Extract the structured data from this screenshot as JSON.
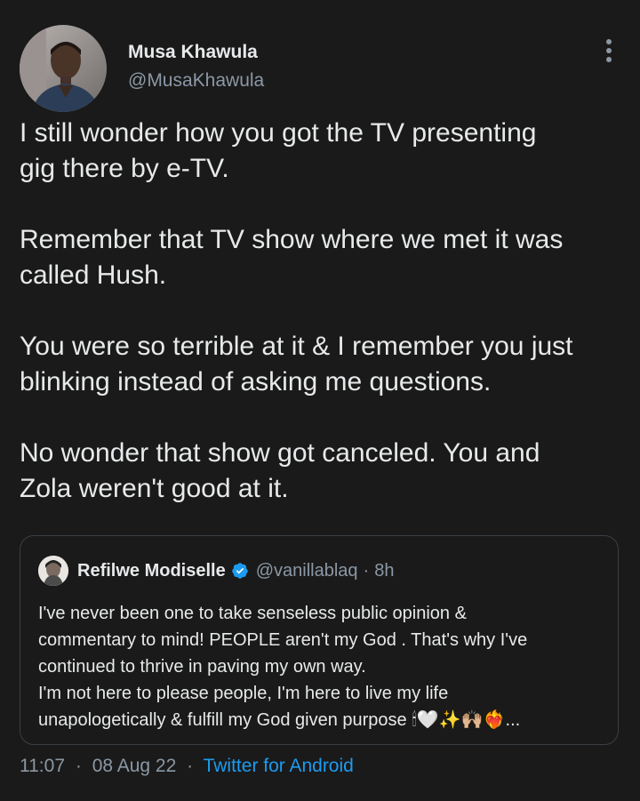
{
  "author": {
    "display_name": "Musa Khawula",
    "handle": "@MusaKhawula"
  },
  "tweet": {
    "paragraphs": [
      "I still wonder how you got the TV presenting\ngig there by e-TV.",
      "Remember that TV show where we met it was\ncalled Hush.",
      "You were so terrible at it & I remember you just\nblinking instead of asking me questions.",
      "No wonder that show got canceled. You and\nZola weren't good at it."
    ]
  },
  "quoted_tweet": {
    "display_name": "Refilwe Modiselle",
    "handle": "@vanillablaq",
    "separator": "·",
    "time": "8h",
    "lines": [
      "I've never been one to take senseless public opinion &",
      "commentary to mind! PEOPLE aren't my God . That's why I've",
      "continued to thrive in paving my own way.",
      "I'm not here to please people, I'm here to live my life",
      "unapologetically & fulfill my God given purpose 🕯🤍✨🙌🏼❤️‍🔥..."
    ]
  },
  "meta": {
    "time": "11:07",
    "date": "08 Aug 22",
    "separator": "·",
    "source": "Twitter for Android"
  },
  "icons": {
    "more": "more-vertical-icon",
    "verified": "verified-badge-icon"
  },
  "colors": {
    "background": "#1a1a1a",
    "text": "#e7e9ea",
    "muted": "#8b98a5",
    "link": "#1d9bf0",
    "verified": "#1d9bf0",
    "border": "#3a3f44"
  }
}
